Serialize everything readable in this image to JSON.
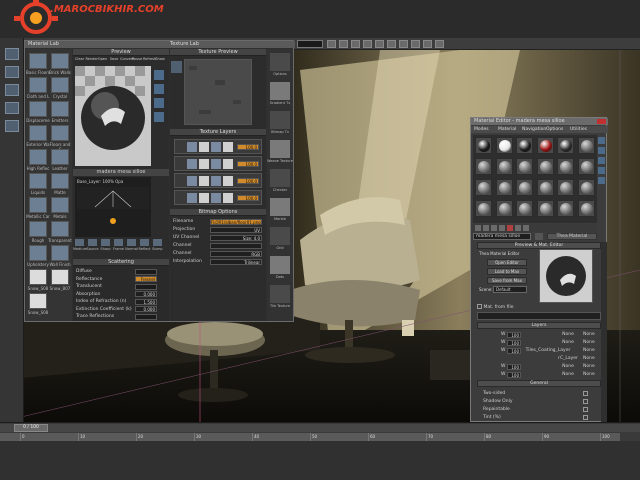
{
  "watermark": {
    "text": "MAROCBIKHIR.COM",
    "dot": "."
  },
  "material_lab": {
    "title": "Material Lab",
    "tab": "Texture Lab",
    "preview_label": "Preview",
    "texture_preview_label": "Texture Preview",
    "texture_layers_label": "Texture Layers",
    "material_name": "madera mesa silloe",
    "toolbar_labels": [
      "Clear",
      "Render",
      "Open",
      "Save",
      "Convert",
      "Pause",
      "Refresh",
      "Show"
    ],
    "library_items": [
      {
        "label": "Basic Floors"
      },
      {
        "label": "Brick Walls"
      },
      {
        "label": "Cloth and L"
      },
      {
        "label": "Crystal"
      },
      {
        "label": "Displaceme"
      },
      {
        "label": "Emitters"
      },
      {
        "label": "Exterior Wa"
      },
      {
        "label": "Floors and C"
      },
      {
        "label": "High Reflec"
      },
      {
        "label": "Leather"
      },
      {
        "label": "Liquids"
      },
      {
        "label": "Matte"
      },
      {
        "label": "Metallic Car"
      },
      {
        "label": "Metals"
      },
      {
        "label": "Rough"
      },
      {
        "label": "Transparent"
      },
      {
        "label": "Upholstery"
      },
      {
        "label": "Wall Finish"
      },
      {
        "label": "Snow_S08"
      },
      {
        "label": "Snow_B07"
      },
      {
        "label": "Snow_S08"
      }
    ],
    "layer_info": "Base_Layer: 100% Opa",
    "bottom_tools": [
      "Medium",
      "Source",
      "Sharp",
      "Frame",
      "Normal",
      "Reflect",
      "Bump"
    ],
    "scattering": {
      "header": "Scattering",
      "rows": [
        {
          "label": "Diffuse",
          "value": ""
        },
        {
          "label": "Reflectance",
          "value": "Fresnel"
        },
        {
          "label": "Translucent",
          "value": ""
        },
        {
          "label": "Absorption",
          "value": "0.000"
        },
        {
          "label": "Index of Refraction (n)",
          "value": "1.500"
        },
        {
          "label": "Extinction Coefficient (k)",
          "value": "0.000"
        },
        {
          "label": "Trace Reflections",
          "value": ""
        }
      ]
    },
    "texture_layer_values": [
      "100.0",
      "100.0",
      "100.0",
      "100.0"
    ],
    "bitmap_options": {
      "header": "Bitmap Options",
      "rows": [
        {
          "label": "Filename",
          "value": "FLOR1/alban/floor01.png"
        },
        {
          "label": "Projection",
          "value": "UV"
        },
        {
          "label": "UV Channel",
          "value": "Size: 4.0"
        },
        {
          "label": "Channel",
          "value": ""
        },
        {
          "label": "Channel",
          "value": "RGB"
        },
        {
          "label": "Interpolation",
          "value": "Trilinear"
        }
      ]
    },
    "right_strip": [
      "Options",
      "Gradient Tx",
      "Bitmap Tx",
      "Weave Texture",
      "Checker",
      "Marble",
      "Grid",
      "Dots",
      "Tile Texture"
    ]
  },
  "material_editor": {
    "title": "Material Editor - madera mesa silloe",
    "menu": [
      "Modes",
      "Material",
      "Navigation",
      "Options",
      "Utilities"
    ],
    "material_name": "madera mesa silloe",
    "material_type": "Thea Material",
    "preview_header": "Preview & Mat. Editor",
    "buttons": [
      "Thea Material Editor",
      "Open Editor",
      "Load to Max",
      "Save from Max"
    ],
    "scene_label": "Scene:",
    "scene_value": "Default",
    "mat_file_label": "Mat. from file",
    "layers_header": "Layers",
    "layer_rows": [
      {
        "name": "W",
        "value": "100",
        "map": "None",
        "tag": "None"
      },
      {
        "name": "W",
        "value": "100",
        "map": "None",
        "tag": "None"
      },
      {
        "name": "W",
        "value": "100",
        "map": "Tiles_Coating_Layer",
        "tag": "None"
      },
      {
        "name": "",
        "value": "",
        "map": "rC_Layer",
        "tag": "None"
      },
      {
        "name": "W",
        "value": "100",
        "map": "None",
        "tag": "None"
      },
      {
        "name": "W",
        "value": "100",
        "map": "None",
        "tag": "None"
      }
    ],
    "general_header": "General",
    "general_rows": [
      "Two-sided",
      "Shadow Only",
      "Repaintable",
      "Tint (%)"
    ]
  },
  "timeline": {
    "frame_label": "0 / 100",
    "ticks": [
      "0",
      "10",
      "20",
      "30",
      "40",
      "50",
      "60",
      "70",
      "80",
      "90",
      "100"
    ]
  }
}
